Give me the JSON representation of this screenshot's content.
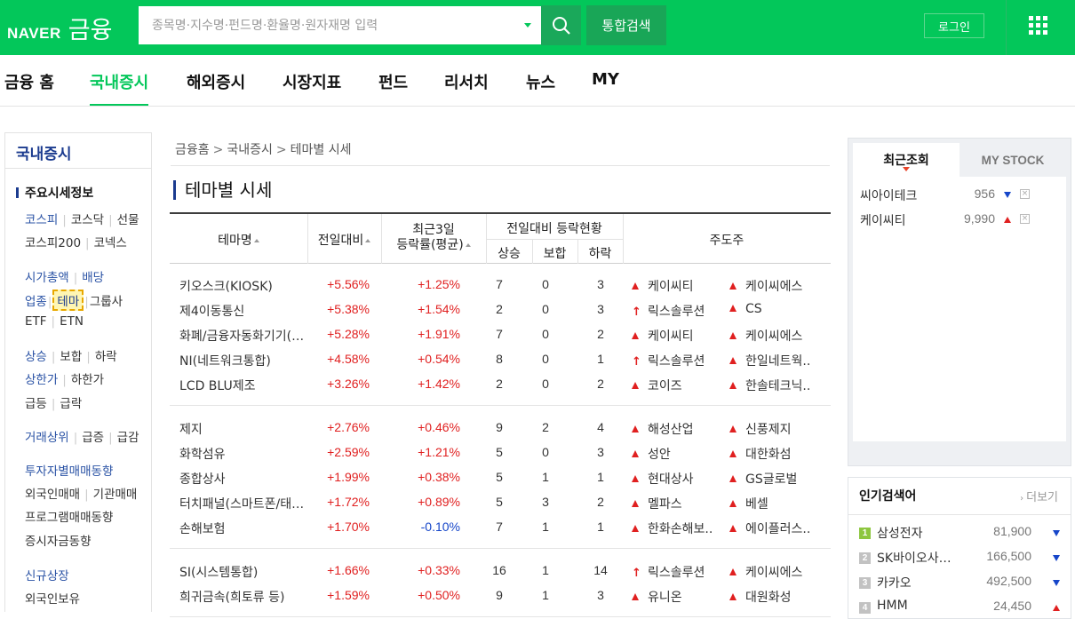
{
  "header": {
    "logo_naver": "NAVER",
    "logo_finance": "금융",
    "search_placeholder": "종목명·지수명·펀드명·환율명·원자재명 입력",
    "total_search": "통합검색",
    "login": "로그인"
  },
  "nav": {
    "tabs": [
      {
        "label": "금융 홈"
      },
      {
        "label": "국내증시",
        "active": true
      },
      {
        "label": "해외증시"
      },
      {
        "label": "시장지표"
      },
      {
        "label": "펀드"
      },
      {
        "label": "리서치"
      },
      {
        "label": "뉴스"
      },
      {
        "label": "MY"
      }
    ]
  },
  "sidebar": {
    "title": "국내증시",
    "section1": "주요시세정보",
    "kospi": "코스피",
    "kosdaq": "코스닥",
    "futures": "선물",
    "kospi200": "코스피200",
    "konex": "코넥스",
    "marketcap": "시가총액",
    "dividend": "배당",
    "industry": "업종",
    "theme": "테마",
    "group": "그룹사",
    "etf": "ETF",
    "etn": "ETN",
    "rise": "상승",
    "flat": "보합",
    "fall": "하락",
    "upper": "상한가",
    "lower": "하한가",
    "surge": "급등",
    "plunge": "급락",
    "volume_top": "거래상위",
    "vol_surge": "급증",
    "vol_drop": "급감",
    "investor": "투자자별매매동향",
    "foreign": "외국인매매",
    "inst": "기관매매",
    "program": "프로그램매매동향",
    "deposit": "증시자금동향",
    "ipo": "신규상장",
    "foreign_hold": "외국인보유"
  },
  "breadcrumb": {
    "home": "금융홈",
    "domestic": "국내증시",
    "current": "테마별 시세"
  },
  "page_title": "테마별 시세",
  "table": {
    "headers": {
      "theme": "테마명",
      "change": "전일대비",
      "recent3_line1": "최근3일",
      "recent3_line2": "등락률(평균)",
      "status": "전일대비 등락현황",
      "up": "상승",
      "flat": "보합",
      "down": "하락",
      "leaders": "주도주"
    },
    "groups": [
      [
        {
          "name": "키오스크(KIOSK)",
          "chg": "+5.56%",
          "r3": "+1.25%",
          "up": "7",
          "flat": "0",
          "down": "3",
          "l1": "케이씨티",
          "l1m": "tri",
          "l2": "케이씨에스",
          "l2m": "tri"
        },
        {
          "name": "제4이동통신",
          "chg": "+5.38%",
          "r3": "+1.54%",
          "up": "2",
          "flat": "0",
          "down": "3",
          "l1": "릭스솔루션",
          "l1m": "arrow",
          "l2": "CS",
          "l2m": "tri"
        },
        {
          "name": "화폐/금융자동화기기(…",
          "chg": "+5.28%",
          "r3": "+1.91%",
          "up": "7",
          "flat": "0",
          "down": "2",
          "l1": "케이씨티",
          "l1m": "tri",
          "l2": "케이씨에스",
          "l2m": "tri"
        },
        {
          "name": "NI(네트워크통합)",
          "chg": "+4.58%",
          "r3": "+0.54%",
          "up": "8",
          "flat": "0",
          "down": "1",
          "l1": "릭스솔루션",
          "l1m": "arrow",
          "l2": "한일네트웍..",
          "l2m": "tri"
        },
        {
          "name": "LCD BLU제조",
          "chg": "+3.26%",
          "r3": "+1.42%",
          "up": "2",
          "flat": "0",
          "down": "2",
          "l1": "코이즈",
          "l1m": "tri",
          "l2": "한솔테크닉..",
          "l2m": "tri"
        }
      ],
      [
        {
          "name": "제지",
          "chg": "+2.76%",
          "r3": "+0.46%",
          "up": "9",
          "flat": "2",
          "down": "4",
          "l1": "해성산업",
          "l1m": "tri",
          "l2": "신풍제지",
          "l2m": "tri"
        },
        {
          "name": "화학섬유",
          "chg": "+2.59%",
          "r3": "+1.21%",
          "up": "5",
          "flat": "0",
          "down": "3",
          "l1": "성안",
          "l1m": "tri",
          "l2": "대한화섬",
          "l2m": "tri"
        },
        {
          "name": "종합상사",
          "chg": "+1.99%",
          "r3": "+0.38%",
          "up": "5",
          "flat": "1",
          "down": "1",
          "l1": "현대상사",
          "l1m": "tri",
          "l2": "GS글로벌",
          "l2m": "tri"
        },
        {
          "name": "터치패널(스마트폰/태…",
          "chg": "+1.72%",
          "r3": "+0.89%",
          "up": "5",
          "flat": "3",
          "down": "2",
          "l1": "멜파스",
          "l1m": "tri",
          "l2": "베셀",
          "l2m": "tri"
        },
        {
          "name": "손해보험",
          "chg": "+1.70%",
          "r3": "-0.10%",
          "up": "7",
          "flat": "1",
          "down": "1",
          "l1": "한화손해보..",
          "l1m": "tri",
          "l2": "에이플러스..",
          "l2m": "tri"
        }
      ],
      [
        {
          "name": "SI(시스템통합)",
          "chg": "+1.66%",
          "r3": "+0.33%",
          "up": "16",
          "flat": "1",
          "down": "14",
          "l1": "릭스솔루션",
          "l1m": "arrow",
          "l2": "케이씨에스",
          "l2m": "tri"
        },
        {
          "name": "희귀금속(희토류 등)",
          "chg": "+1.59%",
          "r3": "+0.50%",
          "up": "9",
          "flat": "1",
          "down": "3",
          "l1": "유니온",
          "l1m": "tri",
          "l2": "대원화성",
          "l2m": "tri"
        }
      ]
    ]
  },
  "right_panel": {
    "tab_recent": "최근조회",
    "tab_mystock": "MY STOCK",
    "recent": [
      {
        "name": "씨아이테크",
        "price": "956",
        "dir": "down"
      },
      {
        "name": "케이씨티",
        "price": "9,990",
        "dir": "up"
      }
    ],
    "popular_title": "인기검색어",
    "more": "더보기",
    "popular": [
      {
        "rank": "1",
        "name": "삼성전자",
        "price": "81,900",
        "dir": "down"
      },
      {
        "rank": "2",
        "name": "SK바이오사…",
        "price": "166,500",
        "dir": "down"
      },
      {
        "rank": "3",
        "name": "카카오",
        "price": "492,500",
        "dir": "down"
      },
      {
        "rank": "4",
        "name": "HMM",
        "price": "24,450",
        "dir": "up"
      }
    ]
  }
}
